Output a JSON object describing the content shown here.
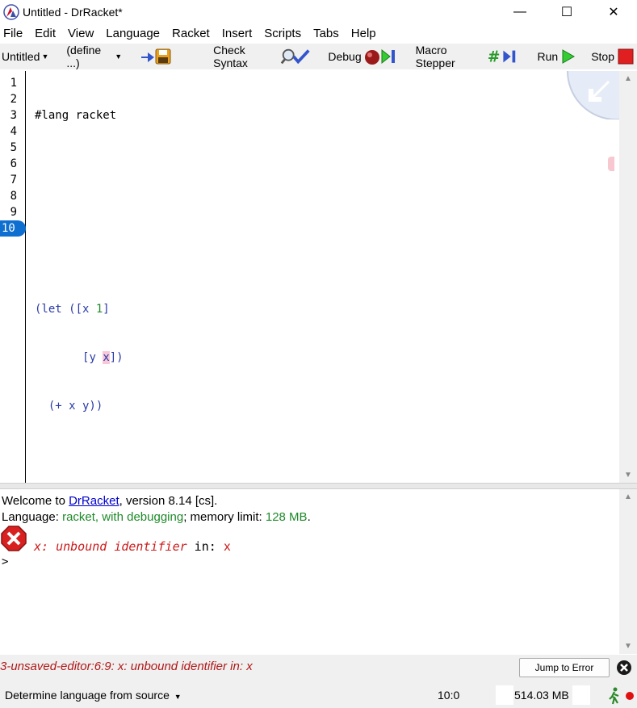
{
  "window": {
    "title": "Untitled - DrRacket*",
    "controls": {
      "minimize": "—",
      "maximize": "☐",
      "close": "✕"
    }
  },
  "menu": [
    "File",
    "Edit",
    "View",
    "Language",
    "Racket",
    "Insert",
    "Scripts",
    "Tabs",
    "Help"
  ],
  "toolbar": {
    "file_dropdown": "Untitled",
    "define_dropdown": "(define ...)",
    "check_syntax": "Check Syntax",
    "debug": "Debug",
    "macro_stepper": "Macro Stepper",
    "run": "Run",
    "stop": "Stop"
  },
  "editor": {
    "line_numbers": [
      "1",
      "2",
      "3",
      "4",
      "5",
      "6",
      "7",
      "8",
      "9",
      "10"
    ],
    "active_line": "10",
    "code": {
      "l1": "#lang racket",
      "l5_open": "(let ([x ",
      "l5_num": "1",
      "l5_close": "]",
      "l6_indent": "       ",
      "l6_open": "[y ",
      "l6_x": "x",
      "l6_close": "])",
      "l7_text": "  (+ x y))"
    }
  },
  "repl": {
    "welcome_prefix": "Welcome to ",
    "welcome_link": "DrRacket",
    "welcome_suffix": ", version 8.14 [cs].",
    "lang_prefix": "Language: ",
    "lang_value": "racket, with debugging",
    "lang_mid": "; memory limit: ",
    "mem_limit": "128 MB",
    "lang_end": ".",
    "error_ident": "x: unbound identifier",
    "error_in": " in: ",
    "error_sym": "x",
    "prompt": ">"
  },
  "error_bar": {
    "message": "3-unsaved-editor:6:9: x: unbound identifier in: x",
    "jump_button": "Jump to Error"
  },
  "status": {
    "language": "Determine language from source",
    "position": "10:0",
    "memory": "514.03 MB"
  },
  "colors": {
    "toolbar_bg": "#f0f0f0",
    "active_line": "#0f6fd0",
    "keyword": "#2a3aa8",
    "number": "#1f8a2a",
    "error": "#cc1a1a"
  }
}
